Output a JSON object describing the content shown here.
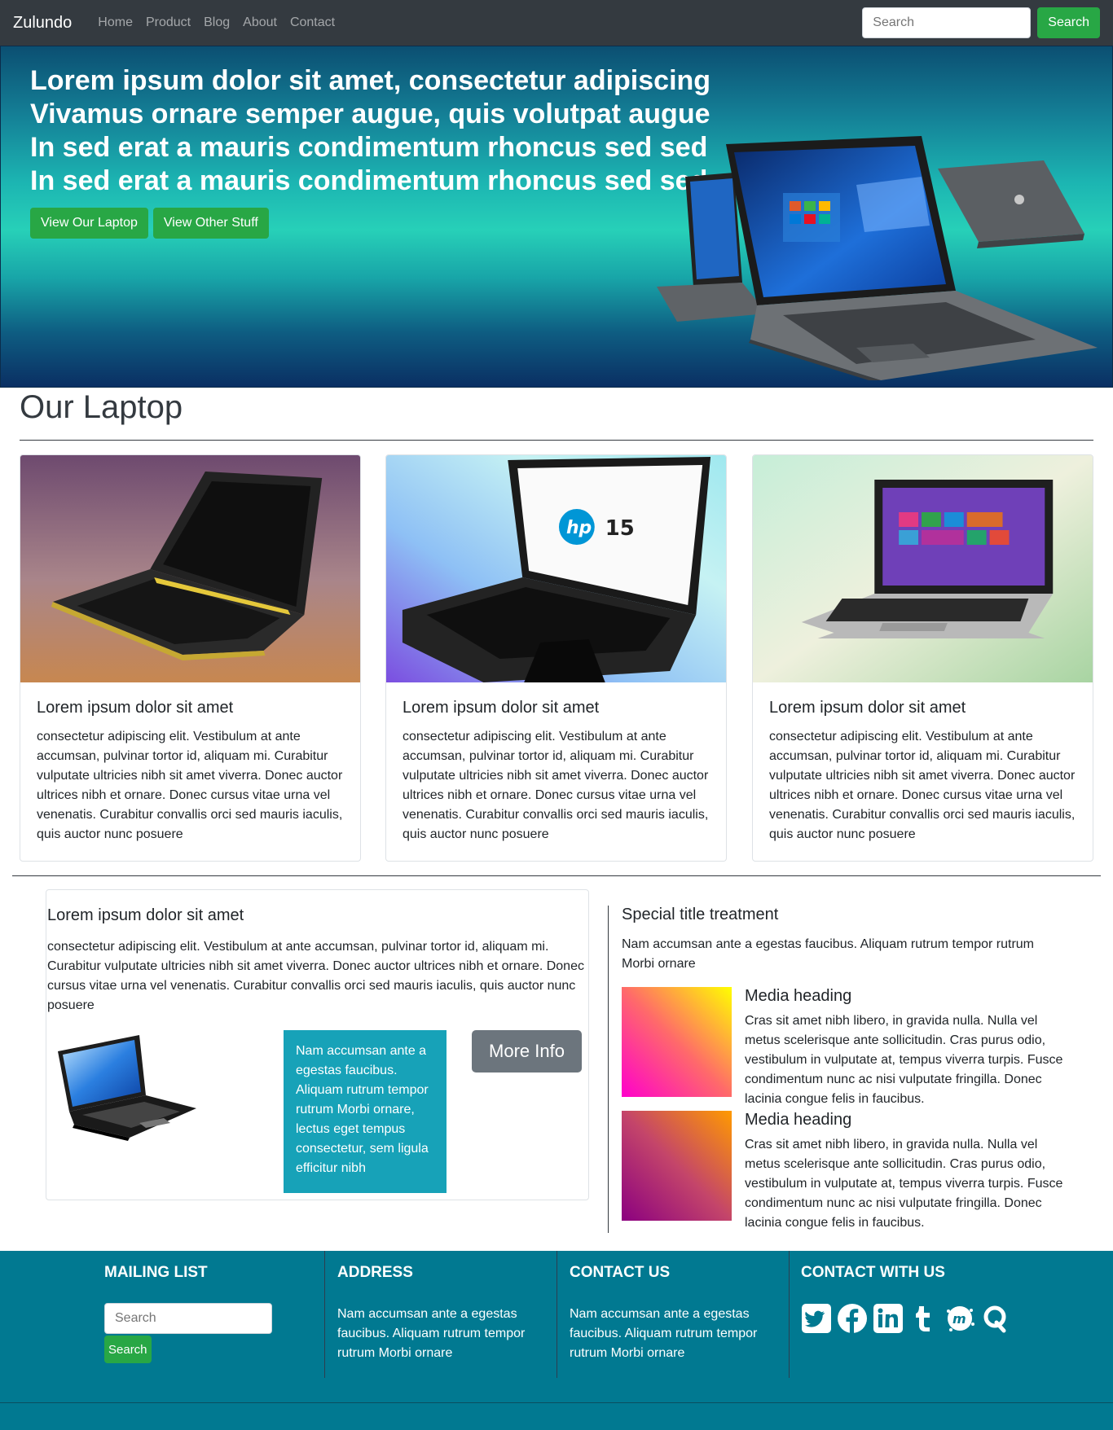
{
  "navbar": {
    "brand": "Zulundo",
    "links": [
      "Home",
      "Product",
      "Blog",
      "About",
      "Contact"
    ],
    "search_placeholder": "Search",
    "search_button": "Search"
  },
  "hero": {
    "lines": [
      "Lorem ipsum dolor sit amet, consectetur adipiscing",
      "Vivamus ornare semper augue, quis volutpat augue",
      "In sed erat a mauris condimentum rhoncus sed sed",
      "In sed erat a mauris condimentum rhoncus sed sed"
    ],
    "button_primary": "View Our Laptop",
    "button_secondary": "View Other Stuff"
  },
  "laptops": {
    "title": "Our Laptop",
    "cards": [
      {
        "title": "Lorem ipsum dolor sit amet",
        "text": "consectetur adipiscing elit. Vestibulum at ante accumsan, pulvinar tortor id, aliquam mi. Curabitur vulputate ultricies nibh sit amet viverra. Donec auctor ultrices nibh et ornare. Donec cursus vitae urna vel venenatis. Curabitur convallis orci sed mauris iaculis, quis auctor nunc posuere"
      },
      {
        "title": "Lorem ipsum dolor sit amet",
        "text": "consectetur adipiscing elit. Vestibulum at ante accumsan, pulvinar tortor id, aliquam mi. Curabitur vulputate ultricies nibh sit amet viverra. Donec auctor ultrices nibh et ornare. Donec cursus vitae urna vel venenatis. Curabitur convallis orci sed mauris iaculis, quis auctor nunc posuere"
      },
      {
        "title": "Lorem ipsum dolor sit amet",
        "text": "consectetur adipiscing elit. Vestibulum at ante accumsan, pulvinar tortor id, aliquam mi. Curabitur vulputate ultricies nibh sit amet viverra. Donec auctor ultrices nibh et ornare. Donec cursus vitae urna vel venenatis. Curabitur convallis orci sed mauris iaculis, quis auctor nunc posuere"
      }
    ],
    "hp_logo_text": "15"
  },
  "feature_card": {
    "title": "Lorem ipsum dolor sit amet",
    "text": "consectetur adipiscing elit. Vestibulum at ante accumsan, pulvinar tortor id, aliquam mi. Curabitur vulputate ultricies nibh sit amet viverra. Donec auctor ultrices nibh et ornare. Donec cursus vitae urna vel venenatis. Curabitur convallis orci sed mauris iaculis, quis auctor nunc posuere",
    "info_box": "Nam accumsan ante a egestas faucibus. Aliquam rutrum tempor rutrum Morbi ornare, lectus eget tempus consectetur, sem ligula efficitur nibh",
    "more_button": "More Info"
  },
  "special": {
    "title": "Special title treatment",
    "text": "Nam accumsan ante a egestas faucibus. Aliquam rutrum tempor rutrum Morbi ornare",
    "media": [
      {
        "heading": "Media heading",
        "text": "Cras sit amet nibh libero, in gravida nulla. Nulla vel metus scelerisque ante sollicitudin. Cras purus odio, vestibulum in vulputate at, tempus viverra turpis. Fusce condimentum nunc ac nisi vulputate fringilla. Donec lacinia congue felis in faucibus."
      },
      {
        "heading": "Media heading",
        "text": "Cras sit amet nibh libero, in gravida nulla. Nulla vel metus scelerisque ante sollicitudin. Cras purus odio, vestibulum in vulputate at, tempus viverra turpis. Fusce condimentum nunc ac nisi vulputate fringilla. Donec lacinia congue felis in faucibus."
      }
    ]
  },
  "footer": {
    "mailing": {
      "title": "MAILING LIST",
      "placeholder": "Search",
      "button": "Search"
    },
    "address": {
      "title": "ADDRESS",
      "text": "Nam accumsan ante a egestas faucibus. Aliquam rutrum tempor rutrum Morbi ornare"
    },
    "contact": {
      "title": "CONTACT US",
      "text": "Nam accumsan ante a egestas faucibus. Aliquam rutrum tempor rutrum Morbi ornare"
    },
    "social": {
      "title": "CONTACT WITH US",
      "icons": [
        "twitter-icon",
        "facebook-icon",
        "linkedin-icon",
        "tumblr-icon",
        "meetup-icon",
        "quora-icon"
      ]
    }
  },
  "colors": {
    "navbar": "#343a40",
    "success": "#28a745",
    "info": "#17a2b8",
    "secondary": "#6c757d",
    "footer": "#017991"
  }
}
